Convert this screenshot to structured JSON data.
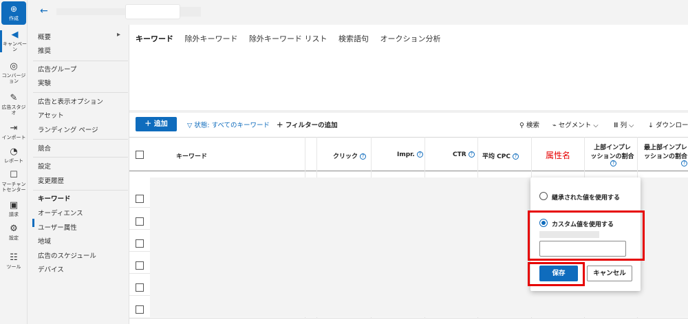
{
  "rail": {
    "create_label": "作成",
    "items": [
      {
        "icon": "megaphone-icon",
        "glyph": "◀",
        "label": "キャンペーン"
      },
      {
        "icon": "target-icon",
        "glyph": "◎",
        "label": "コンバージョン"
      },
      {
        "icon": "studio-icon",
        "glyph": "✎",
        "label": "広告スタジオ"
      },
      {
        "icon": "import-icon",
        "glyph": "⇥",
        "label": "インポート"
      },
      {
        "icon": "report-icon",
        "glyph": "◔",
        "label": "レポート"
      },
      {
        "icon": "merchant-icon",
        "glyph": "☐",
        "label": "マーチャントセンター"
      },
      {
        "icon": "billing-icon",
        "glyph": "▣",
        "label": "請求"
      },
      {
        "icon": "gear-icon",
        "glyph": "⚙",
        "label": "設定"
      },
      {
        "icon": "tools-icon",
        "glyph": "☷",
        "label": "ツール"
      }
    ]
  },
  "leftnav": {
    "items": [
      "概要",
      "推奨",
      "広告グループ",
      "実験",
      "広告と表示オプション",
      "アセット",
      "ランディング ページ",
      "競合",
      "設定",
      "変更履歴",
      "キーワード",
      "オーディエンス",
      "ユーザー属性",
      "地域",
      "広告のスケジュール",
      "デバイス"
    ],
    "active": "キーワード"
  },
  "tabs": [
    "キーワード",
    "除外キーワード",
    "除外キーワード リスト",
    "検索語句",
    "オークション分析"
  ],
  "toolbar": {
    "add_label": "追加",
    "filter_status": "状態: すべてのキーワード",
    "add_filter": "フィルターの追加",
    "search": "検索",
    "segment": "セグメント",
    "columns": "列",
    "download": "ダウンロー"
  },
  "table": {
    "headers": {
      "keyword": "キーワード",
      "clicks": "クリック",
      "impr": "Impr.",
      "ctr": "CTR",
      "avg_cpc": "平均 CPC",
      "attr": "属性名",
      "top_impr_line1": "上部インプレ",
      "top_impr_line2": "ッションの割合",
      "abs_top_line1": "最上部インプレ",
      "abs_top_line2": "ッションの割合"
    }
  },
  "popup": {
    "inherit_label": "継承された値を使用する",
    "custom_label": "カスタム値を使用する",
    "save": "保存",
    "cancel": "キャンセル"
  },
  "colors": {
    "accent": "#0f6cbd",
    "highlight": "#e60000"
  }
}
